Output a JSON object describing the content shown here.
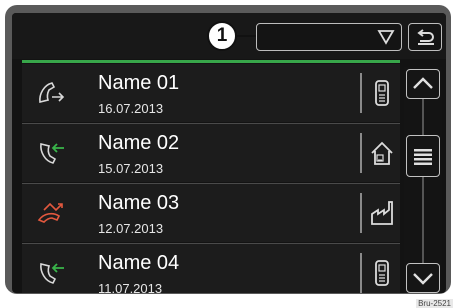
{
  "header": {
    "callout_number": "1",
    "dropdown": {
      "selected_value": ""
    },
    "icons": {
      "dropdown": "chevron-down-icon",
      "back": "back-arrow-icon"
    }
  },
  "contacts": [
    {
      "name": "Name 01",
      "date": "16.07.2013",
      "call_type": "outgoing-call",
      "number_type": "mobile-phone"
    },
    {
      "name": "Name 02",
      "date": "15.07.2013",
      "call_type": "incoming-call",
      "number_type": "home"
    },
    {
      "name": "Name 03",
      "date": "12.07.2013",
      "call_type": "missed-call",
      "number_type": "work"
    },
    {
      "name": "Name 04",
      "date": "11.07.2013",
      "call_type": "incoming-call",
      "number_type": "mobile-phone"
    }
  ],
  "sidebar": {
    "icons": {
      "scroll_up": "chevron-up-icon",
      "list": "list-icon",
      "scroll_down": "chevron-down-icon"
    }
  },
  "colors": {
    "accent_green": "#38a64a",
    "outgoing": "#d9d9d9",
    "incoming": "#39b54a",
    "missed": "#e2583e",
    "background": "#131313"
  },
  "watermark": "Bru-2521"
}
